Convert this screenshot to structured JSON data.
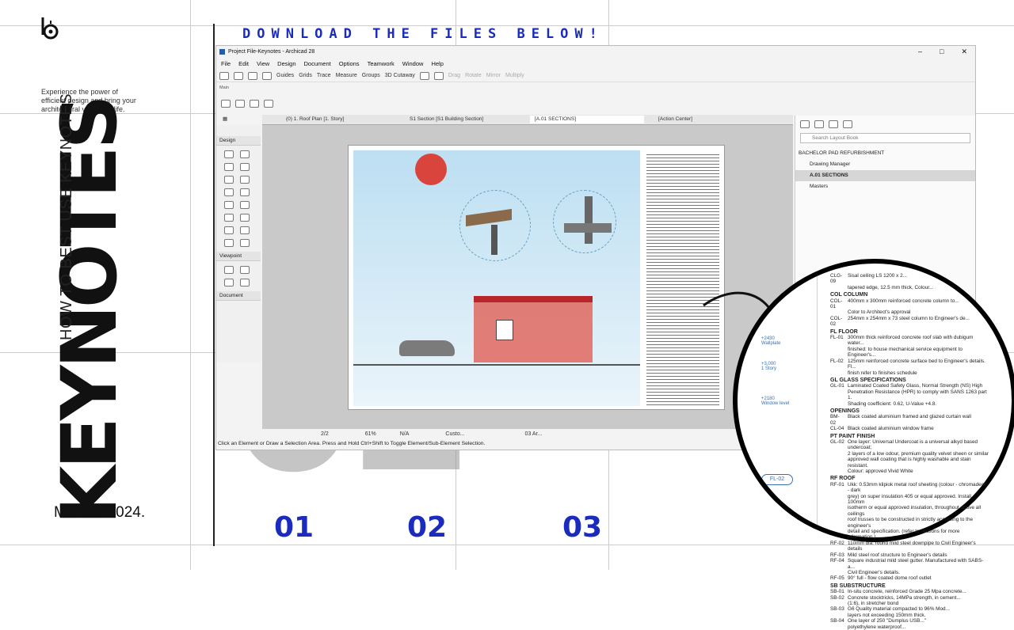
{
  "brand": {
    "logo_letters": "b"
  },
  "banner": {
    "download": "DOWNLOAD THE FILES BELOW!"
  },
  "side": {
    "tagline": [
      "Experience the power of",
      "efficient design and bring your",
      "architectural visions to life."
    ],
    "title": "KEYNOTES",
    "subtitle": "HOW TO BEST USE KEYNOTES",
    "credit": "MSBIM 2024.",
    "episode": "02"
  },
  "steps": [
    "01",
    "02",
    "03"
  ],
  "window": {
    "title": "Project File-Keynotes - Archicad 28",
    "menu": [
      "File",
      "Edit",
      "View",
      "Design",
      "Document",
      "Options",
      "Teamwork",
      "Window",
      "Help"
    ],
    "toolbar": {
      "guides": "Guides",
      "grids": "Grids",
      "trace": "Trace",
      "measure": "Measure",
      "groups": "Groups",
      "cutaway": "3D Cutaway",
      "drag": "Drag",
      "rotate": "Rotate",
      "mirror": "Mirror",
      "multiply": "Multiply"
    },
    "info_label": "Main",
    "tabs": [
      "(0) 1. Roof Plan [1. Story]",
      "S1 Section [S1 Building Section]",
      "[A.01 SECTIONS]",
      "[Action Center]"
    ],
    "toolbox": {
      "design": "Design",
      "viewpoint": "Viewpoint",
      "document": "Document"
    },
    "navigator": {
      "search_placeholder": "Search Layout Book",
      "items": [
        "BACHELOR PAD REFURBISHMENT",
        "Drawing Manager",
        "A.01 SECTIONS",
        "Masters"
      ]
    },
    "status": {
      "page": "2/2",
      "zoom": "61%",
      "na": "N/A",
      "custom": "Custo...",
      "layout": "03 Ar..."
    },
    "hint": "Click an Element or Draw a Selection Area. Press and Hold Ctrl+Shift to Toggle Element/Sub-Element Selection."
  },
  "detail": {
    "labels": {
      "wallplate": "Wallplate",
      "story": "1 Story",
      "window": "Window level",
      "level1": "+2430",
      "level2": "+3,000",
      "level3": "+2180",
      "tag": "FL-02"
    },
    "sections": [
      {
        "rows": [
          [
            "CLG-09",
            "Sisal ceiling LS 1200 x 2..."
          ],
          [
            "",
            "tapered edge, 12.5 mm thick, Colour..."
          ]
        ]
      },
      {
        "h": "COL COLUMN",
        "rows": [
          [
            "COL-01",
            "400mm x 300mm reinforced concrete column to..."
          ],
          [
            "",
            "Color to Architect's approval"
          ],
          [
            "COL-02",
            "254mm x 254mm x 73 steel column to Engineer's de..."
          ]
        ]
      },
      {
        "h": "FL FLOOR",
        "rows": [
          [
            "FL-01",
            "300mm thick reinforced concrete roof slab with dubigum water..."
          ],
          [
            "",
            "finished: to house mechanical service equipment to Engineer's..."
          ],
          [
            "FL-02",
            "125mm reinforced concrete surface bed to Engineer's details. Fl..."
          ],
          [
            "",
            "finish refer to finishes schedule"
          ]
        ]
      },
      {
        "h": "GL GLASS SPECIFICATIONS",
        "rows": [
          [
            "GL-01",
            "Laminated Coated Safety Glass, Normal Strength (NS) High"
          ],
          [
            "",
            "Penetration Resistance (HPR) to comply with SANS 1263 part 1."
          ],
          [
            "",
            "Shading coefficient: 0.62, U-Value +4.8."
          ]
        ]
      },
      {
        "h": "OPENINGS",
        "rows": [
          [
            "BM-02",
            "Black coated aluminium framed and glazed curtain wall"
          ],
          [
            "CL-04",
            "Black coated aluminium window frame"
          ]
        ]
      },
      {
        "h": "PT PAINT FINISH",
        "rows": [
          [
            "GL-02",
            "One layer: Universal Undercoat is a universal alkyd based undercoat;"
          ],
          [
            "",
            "2 layers of a low odour, premium quality velvet sheen or similar"
          ],
          [
            "",
            "approved wall coating that is highly washable and stain resistant."
          ],
          [
            "",
            "Colour: approved Vivid White"
          ]
        ]
      },
      {
        "h": "RF ROOF",
        "rows": [
          [
            "RF-01",
            "Ukk: 0.53mm klipiok metal roof sheeting (colour - chromadeck - dark"
          ],
          [
            "",
            "grey) on super insulation 405 or equal approved. Install 100mm"
          ],
          [
            "",
            "isotherm or equal approved insulation, throughout above all ceilings"
          ],
          [
            "",
            "roof trusses to be constructed in strictly according to the engineer's"
          ],
          [
            "",
            "detail and specification. (refer to sections for more information.)"
          ],
          [
            "RF-02",
            "110mm dia. round mild steel downpipe to Civil Engineer's details"
          ],
          [
            "RF-03",
            "Mild steel roof structure to Engineer's details"
          ],
          [
            "RF-04",
            "Square industrial mild steel gutter. Manufactured with SABS-a..."
          ],
          [
            "",
            "Civil Engineer's details."
          ],
          [
            "RF-05",
            "90° full - flow coated dome roof outlet"
          ]
        ]
      },
      {
        "h": "SB SUBSTRUCTURE",
        "rows": [
          [
            "SB-01",
            "In-situ concrete, reinforced Grade 25 Mpa concrete..."
          ],
          [
            "SB-02",
            "Concrete stocktricks, 14MPa strength, in cement..."
          ],
          [
            "",
            "(1:6), in stretcher bond"
          ],
          [
            "SB-03",
            "G6 Quality material compacted to 96% Mod..."
          ],
          [
            "",
            "layers not exceeding 150mm thick."
          ],
          [
            "SB-04",
            "One layer of 250 \"Dumplus USB...\""
          ],
          [
            "",
            "polyethylene waterproof..."
          ]
        ]
      }
    ]
  }
}
